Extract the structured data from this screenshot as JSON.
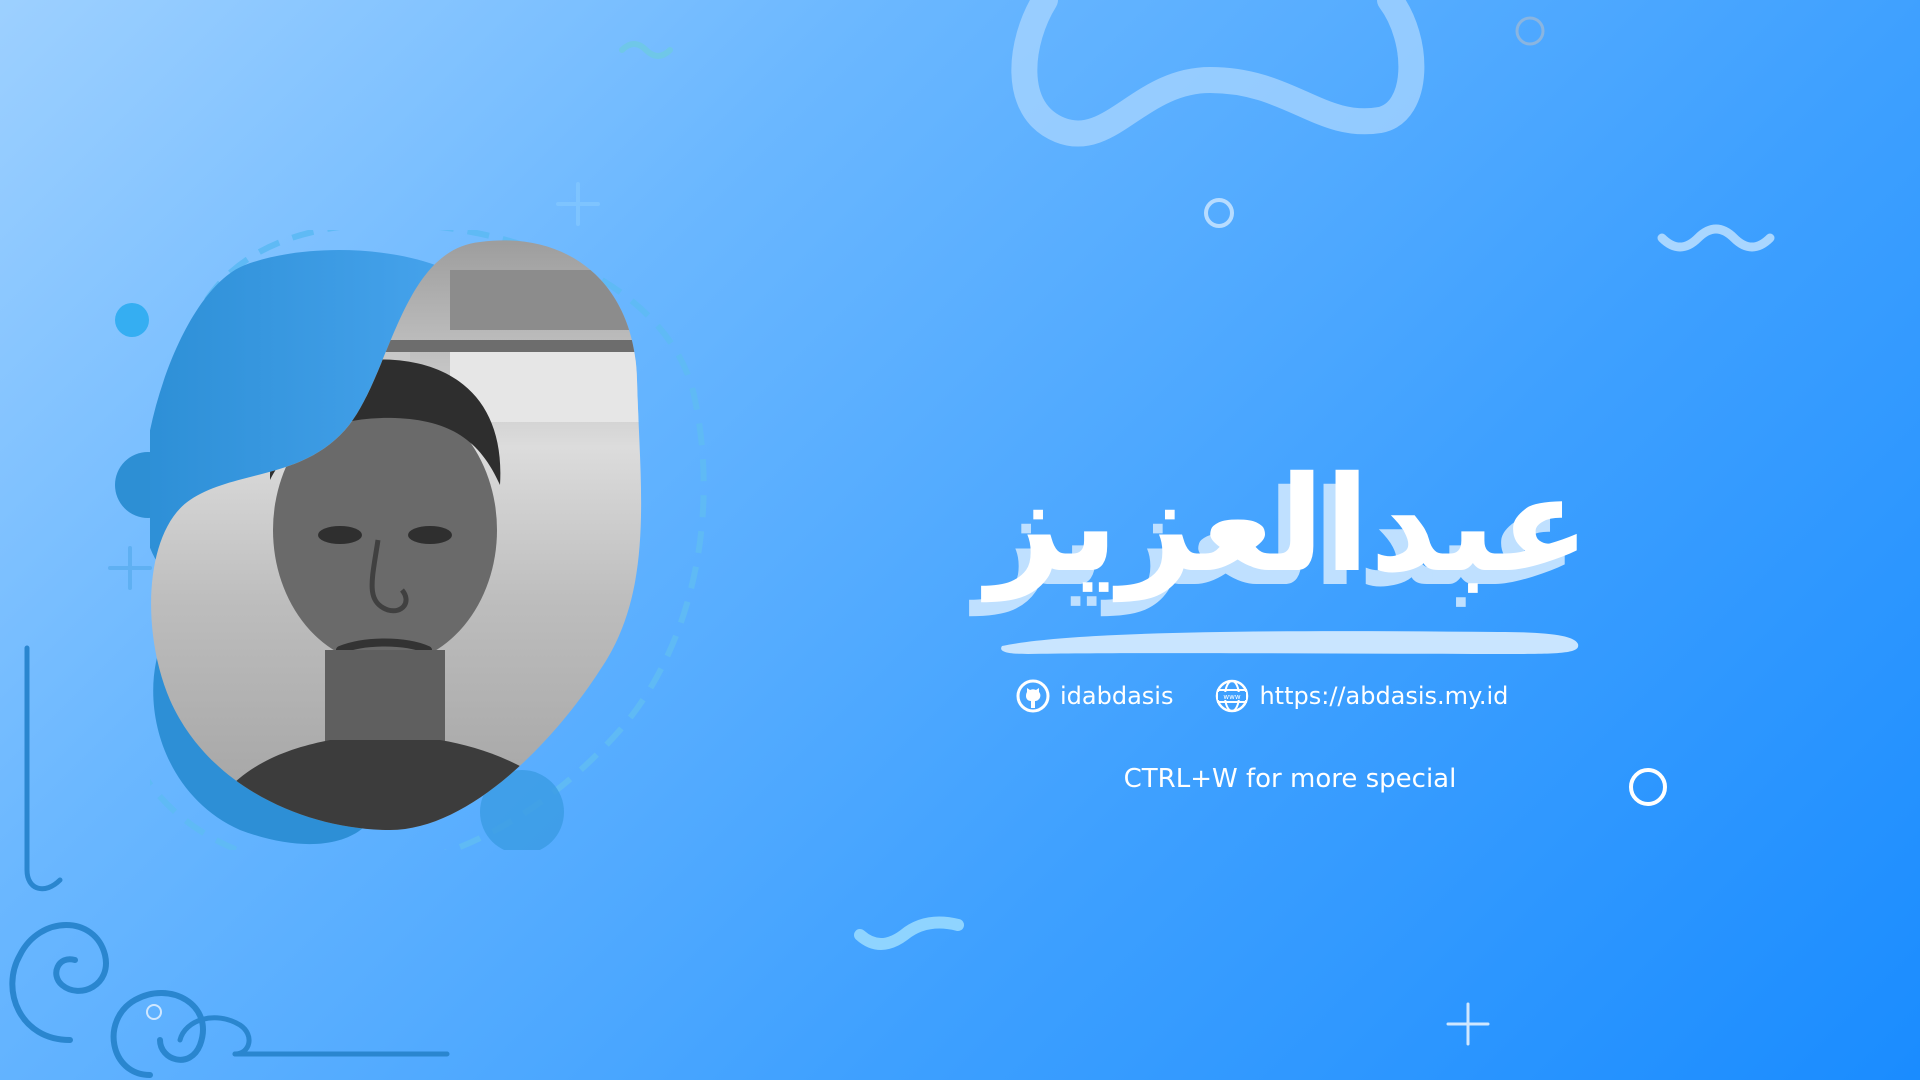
{
  "profile": {
    "name": "عبدالعزيز",
    "photo_alt": "portrait",
    "links": [
      {
        "icon": "github-icon",
        "label": "idabdasis"
      },
      {
        "icon": "globe-www-icon",
        "label": "https://abdasis.my.id"
      }
    ],
    "tagline": "CTRL+W for more special"
  },
  "colors": {
    "background_start": "#9dd0ff",
    "background_end": "#1a8cff",
    "blob_dark": "#2f8fd6",
    "accent_light": "#bfe0ff",
    "text": "#ffffff"
  }
}
